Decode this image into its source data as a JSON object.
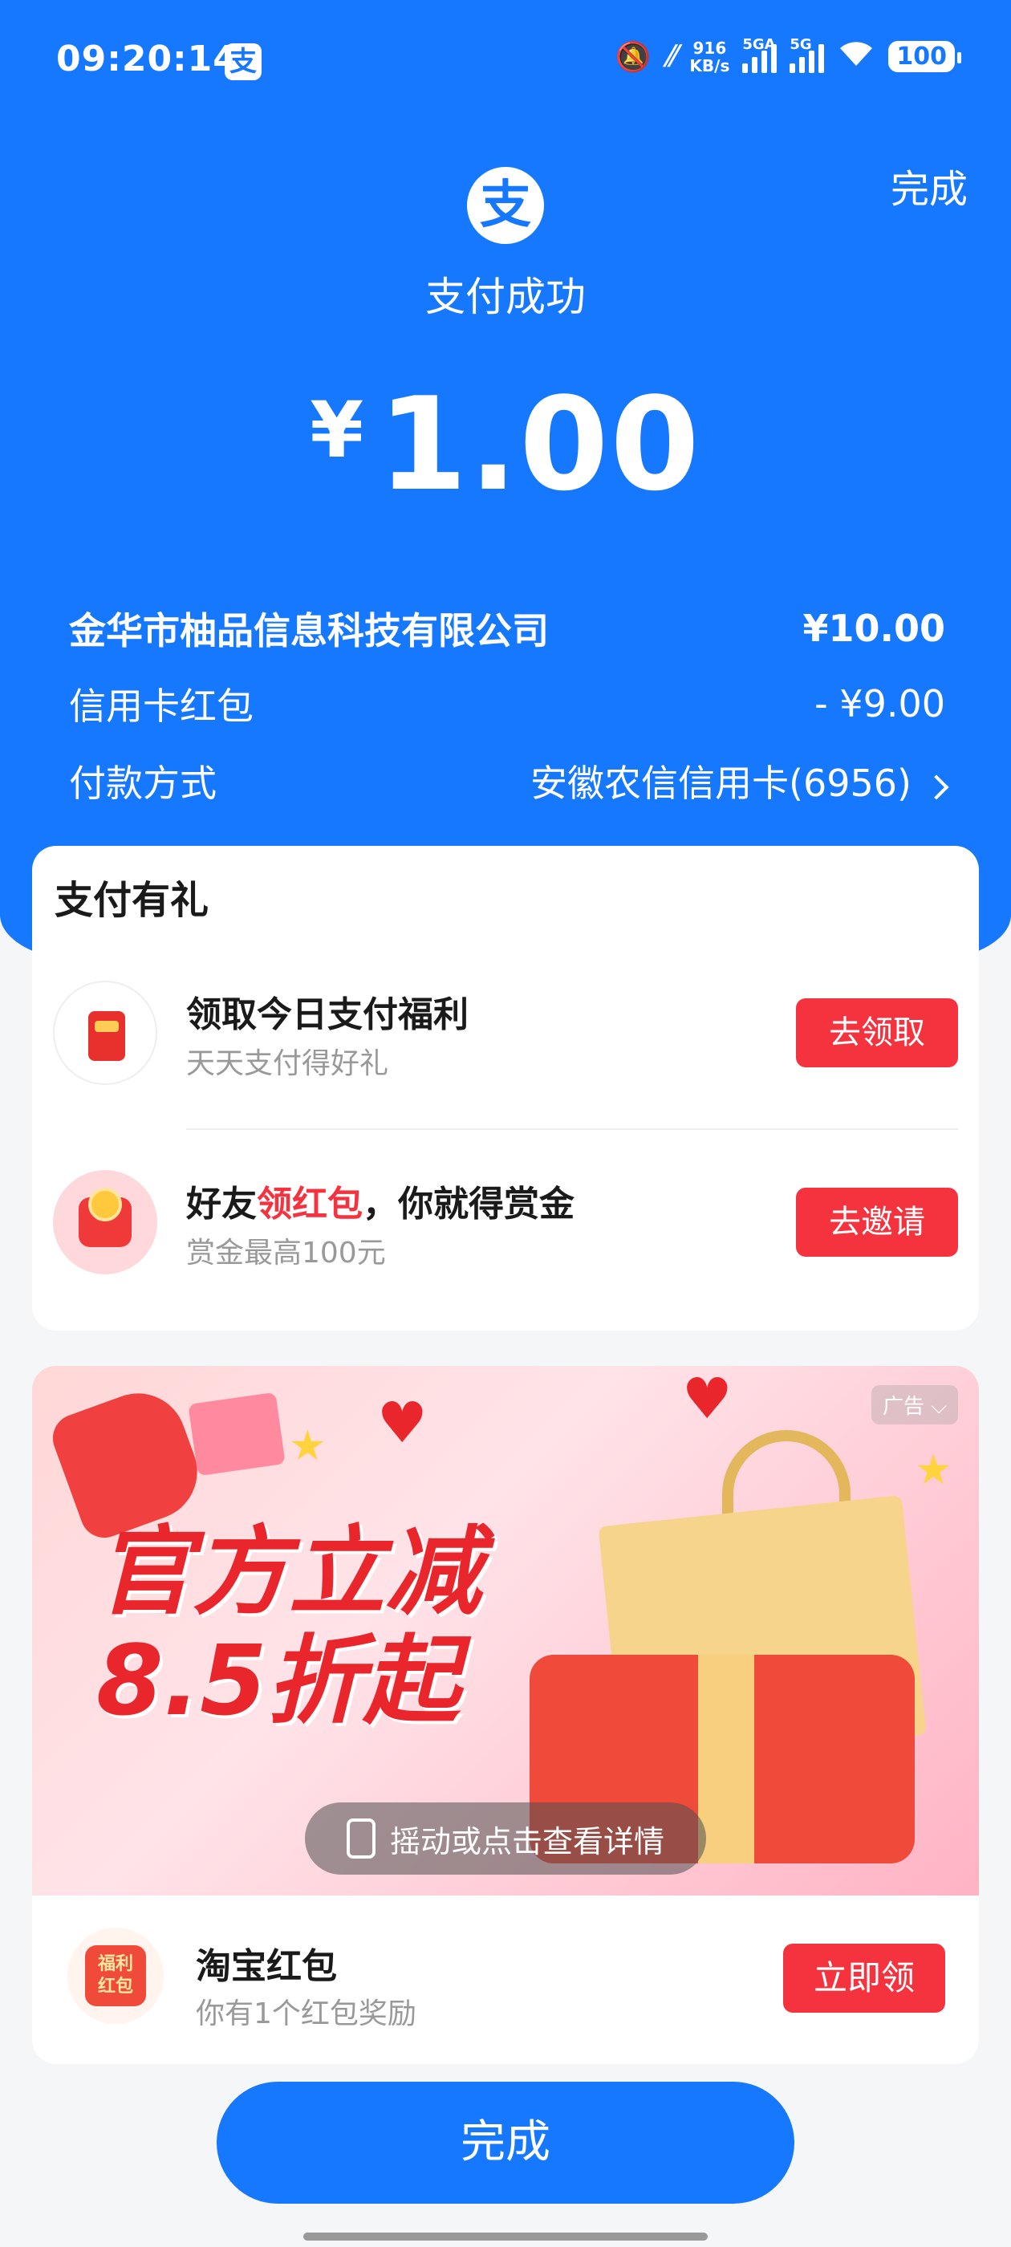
{
  "status_bar": {
    "time": "09:20:14",
    "app_glyph": "支",
    "net_speed_value": "916",
    "net_speed_unit": "KB/s",
    "sig1_label": "5GA",
    "sig2_label": "5G",
    "battery": "100"
  },
  "header": {
    "done_label": "完成",
    "logo_glyph": "支",
    "status_text": "支付成功",
    "currency": "¥",
    "amount": "1.00"
  },
  "details": {
    "merchant": "金华市柚品信息科技有限公司",
    "merchant_amount": "¥10.00",
    "discount_label": "信用卡红包",
    "discount_amount": "- ¥9.00",
    "method_label": "付款方式",
    "method_value": "安徽农信信用卡(6956)"
  },
  "rewards": {
    "title": "支付有礼",
    "items": [
      {
        "title": "领取今日支付福利",
        "subtitle": "天天支付得好礼",
        "button": "去领取"
      },
      {
        "title_prefix": "好友",
        "title_highlight": "领红包",
        "title_suffix": "，你就得赏金",
        "subtitle": "赏金最高100元",
        "button": "去邀请"
      }
    ]
  },
  "ad": {
    "tag": "广告",
    "headline_line1": "官方立减",
    "headline_line2": "8.5折起",
    "hint": "摇动或点击查看详情",
    "icon_text_line1": "福利",
    "icon_text_line2": "红包",
    "title": "淘宝红包",
    "subtitle": "你有1个红包奖励",
    "button": "立即领"
  },
  "footer": {
    "done_label": "完成"
  },
  "colors": {
    "brand_blue": "#1677ff",
    "accent_red": "#f5333f"
  }
}
